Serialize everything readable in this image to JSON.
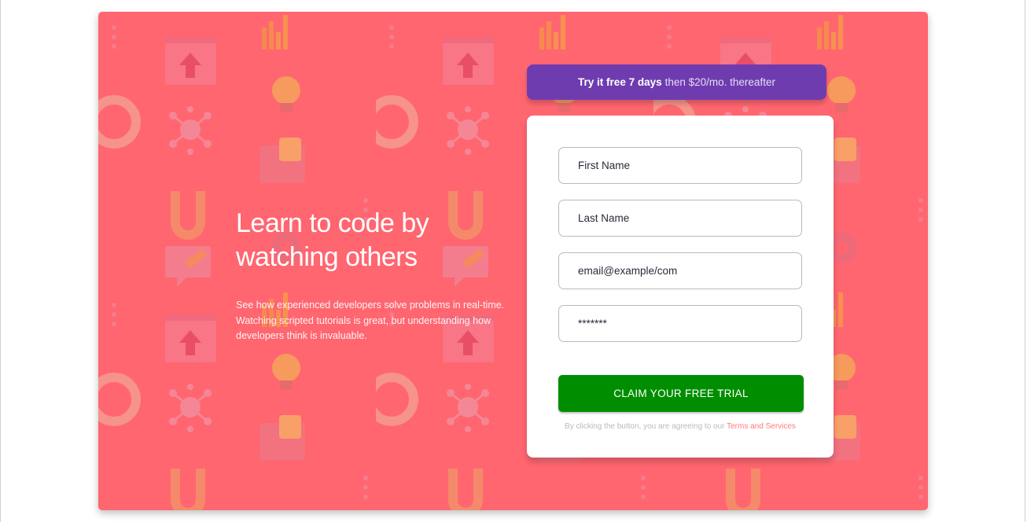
{
  "hero": {
    "title": "Learn to code by watching others",
    "description": "See how experienced developers solve problems in real-time. Watching scripted tutorials is great, but understanding how developers think is invaluable.",
    "background_color": "#ff6670",
    "pattern_icons": [
      "upload-window-icon",
      "network-nodes-icon",
      "bar-chart-icon",
      "thumbs-up-icon",
      "magnet-icon",
      "chat-bubble-icon",
      "gear-icon",
      "lifebuoy-icon",
      "lightbulb-icon",
      "key-icon",
      "puzzle-icon"
    ]
  },
  "trial_banner": {
    "bold_text": "Try it free 7 days",
    "rest_text": "then $20/mo. thereafter",
    "color": "#6f3cb0"
  },
  "form": {
    "first_name_placeholder": "First Name",
    "last_name_placeholder": "Last Name",
    "email_placeholder": "email@example/com",
    "password_placeholder": "*******",
    "submit_label": "CLAIM YOUR FREE TRIAL",
    "submit_color": "#008e00",
    "legal_text": "By clicking the button, you are agreeing to our",
    "terms_link": "Terms and Services"
  }
}
